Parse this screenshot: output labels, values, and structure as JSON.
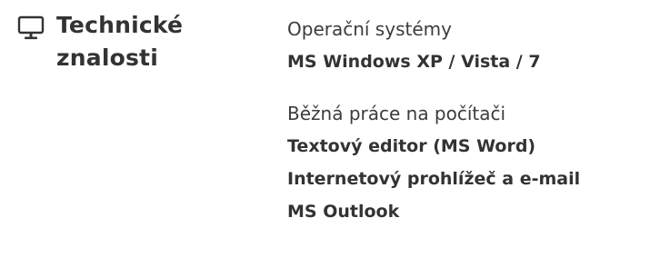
{
  "section": {
    "icon": "monitor-icon",
    "title_line1": "Technické",
    "title_line2": "znalosti"
  },
  "groups": [
    {
      "title": "Operační systémy",
      "items": [
        "MS Windows XP / Vista / 7"
      ]
    },
    {
      "title": "Běžná práce na počítači",
      "items": [
        "Textový editor (MS Word)",
        "Internetový prohlížeč a e-mail",
        "MS Outlook"
      ]
    }
  ],
  "colors": {
    "text": "#333333",
    "background": "#ffffff"
  }
}
